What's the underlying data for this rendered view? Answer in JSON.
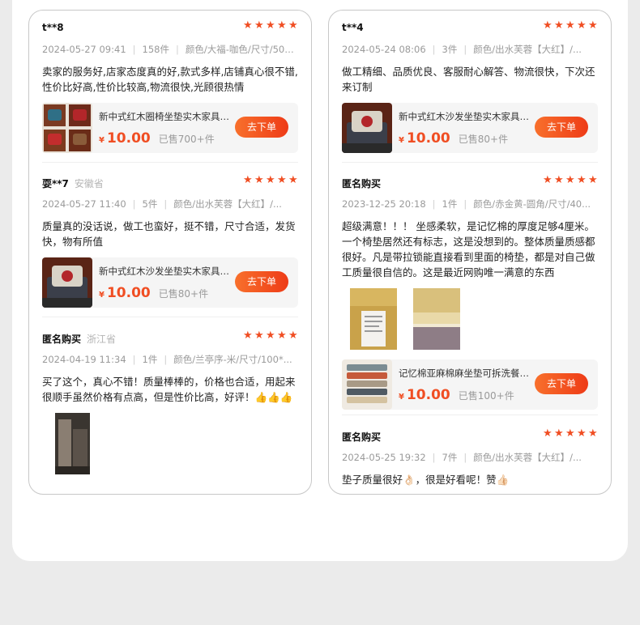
{
  "colors": {
    "accent": "#f04e23",
    "star": "#f04e23",
    "muted": "#9a9a9a"
  },
  "reviews_left": [
    {
      "user": "t**8",
      "region": "",
      "rating": 5,
      "date": "2024-05-27 09:41",
      "qty": "158件",
      "spec": "颜色/大福-咖色/尺寸/50*5...",
      "text": "卖家的服务好,店家态度真的好,款式多样,店铺真心很不错,性价比好高,性价比较高,物流很快,光顾很热情",
      "product": {
        "name": "新中式红木圈椅坐垫实木家具茶...",
        "price": "10.00",
        "sold": "已售700+件",
        "button": "去下单",
        "currency": "¥"
      }
    },
    {
      "user": "耍**7",
      "region": "安徽省",
      "rating": 5,
      "date": "2024-05-27 11:40",
      "qty": "5件",
      "spec": "颜色/出水芙蓉【大红】/...",
      "text": "质量真的没话说，做工也蛮好，挺不错，尺寸合适，发货快，物有所值",
      "product": {
        "name": "新中式红木沙发坐垫实木家具座...",
        "price": "10.00",
        "sold": "已售80+件",
        "button": "去下单",
        "currency": "¥"
      }
    },
    {
      "user": "匿名购买",
      "region": "浙江省",
      "rating": 5,
      "date": "2024-04-19 11:34",
      "qty": "1件",
      "spec": "颜色/兰亭序-米/尺寸/100*...",
      "text": "买了这个，真心不错！质量棒棒的，价格也合适，用起来很顺手虽然价格有点高，但是性价比高，好评！👍👍👍"
    }
  ],
  "reviews_right": [
    {
      "user": "t**4",
      "region": "",
      "rating": 5,
      "date": "2024-05-24 08:06",
      "qty": "3件",
      "spec": "颜色/出水芙蓉【大红】/...",
      "text": "做工精细、品质优良、客服耐心解答、物流很快，下次还来订制",
      "product": {
        "name": "新中式红木沙发坐垫实木家具座...",
        "price": "10.00",
        "sold": "已售80+件",
        "button": "去下单",
        "currency": "¥"
      }
    },
    {
      "user": "匿名购买",
      "region": "",
      "rating": 5,
      "date": "2023-12-25 20:18",
      "qty": "1件",
      "spec": "颜色/赤金黄-圆角/尺寸/40...",
      "text": "超级满意！！！ 坐感柔软，是记忆棉的厚度足够4厘米。一个椅垫居然还有标志，这是没想到的。整体质量质感都很好。凡是带拉锁能直接看到里面的椅垫，都是对自己做工质量很自信的。这是最近网购唯一满意的东西",
      "product": {
        "name": "记忆棉亚麻棉麻坐垫可拆洗餐桌...",
        "price": "10.00",
        "sold": "已售100+件",
        "button": "去下单",
        "currency": "¥"
      }
    },
    {
      "user": "匿名购买",
      "region": "",
      "rating": 5,
      "date": "2024-05-25 19:32",
      "qty": "7件",
      "spec": "颜色/出水芙蓉【大红】/...",
      "text": "垫子质量很好👌🏻，很是好看呢！赞👍🏻"
    }
  ]
}
